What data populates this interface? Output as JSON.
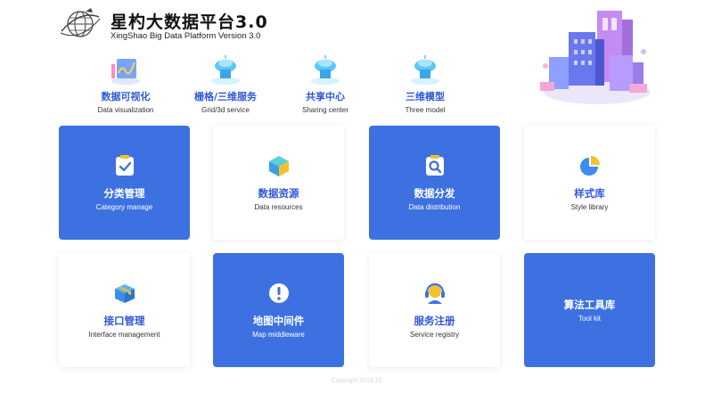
{
  "header": {
    "title": "星杓大数据平台3.0",
    "subtitle": "XingShao Big Data Platform Version 3.0"
  },
  "nav": [
    {
      "zh": "数据可视化",
      "en": "Data visualization",
      "icon": "chart-screen-icon"
    },
    {
      "zh": "栅格/三维服务",
      "en": "Grid/3d service",
      "icon": "cloud-server-icon"
    },
    {
      "zh": "共享中心",
      "en": "Sharing center",
      "icon": "cloud-server-icon"
    },
    {
      "zh": "三维模型",
      "en": "Three model",
      "icon": "cloud-server-icon"
    }
  ],
  "cards": [
    {
      "zh": "分类管理",
      "en": "Category manage",
      "icon": "clipboard-check-icon",
      "style": "blue"
    },
    {
      "zh": "数据资源",
      "en": "Data resources",
      "icon": "cube-icon",
      "style": "white"
    },
    {
      "zh": "数据分发",
      "en": "Data distribution",
      "icon": "clipboard-search-icon",
      "style": "blue"
    },
    {
      "zh": "样式库",
      "en": "Style library",
      "icon": "pie-chart-icon",
      "style": "white"
    },
    {
      "zh": "接口管理",
      "en": "Interface management",
      "icon": "box-icon",
      "style": "white"
    },
    {
      "zh": "地图中间件",
      "en": "Map middleware",
      "icon": "alert-circle-icon",
      "style": "blue"
    },
    {
      "zh": "服务注册",
      "en": "Service registry",
      "icon": "headset-icon",
      "style": "white"
    },
    {
      "zh": "算法工具库",
      "en": "Tool kit",
      "icon": "",
      "style": "blue"
    }
  ],
  "footer": {
    "text": "Copyright 2018.10"
  },
  "colors": {
    "accent": "#3d71e1",
    "link": "#2f58d8",
    "yellow": "#f5c02a"
  }
}
